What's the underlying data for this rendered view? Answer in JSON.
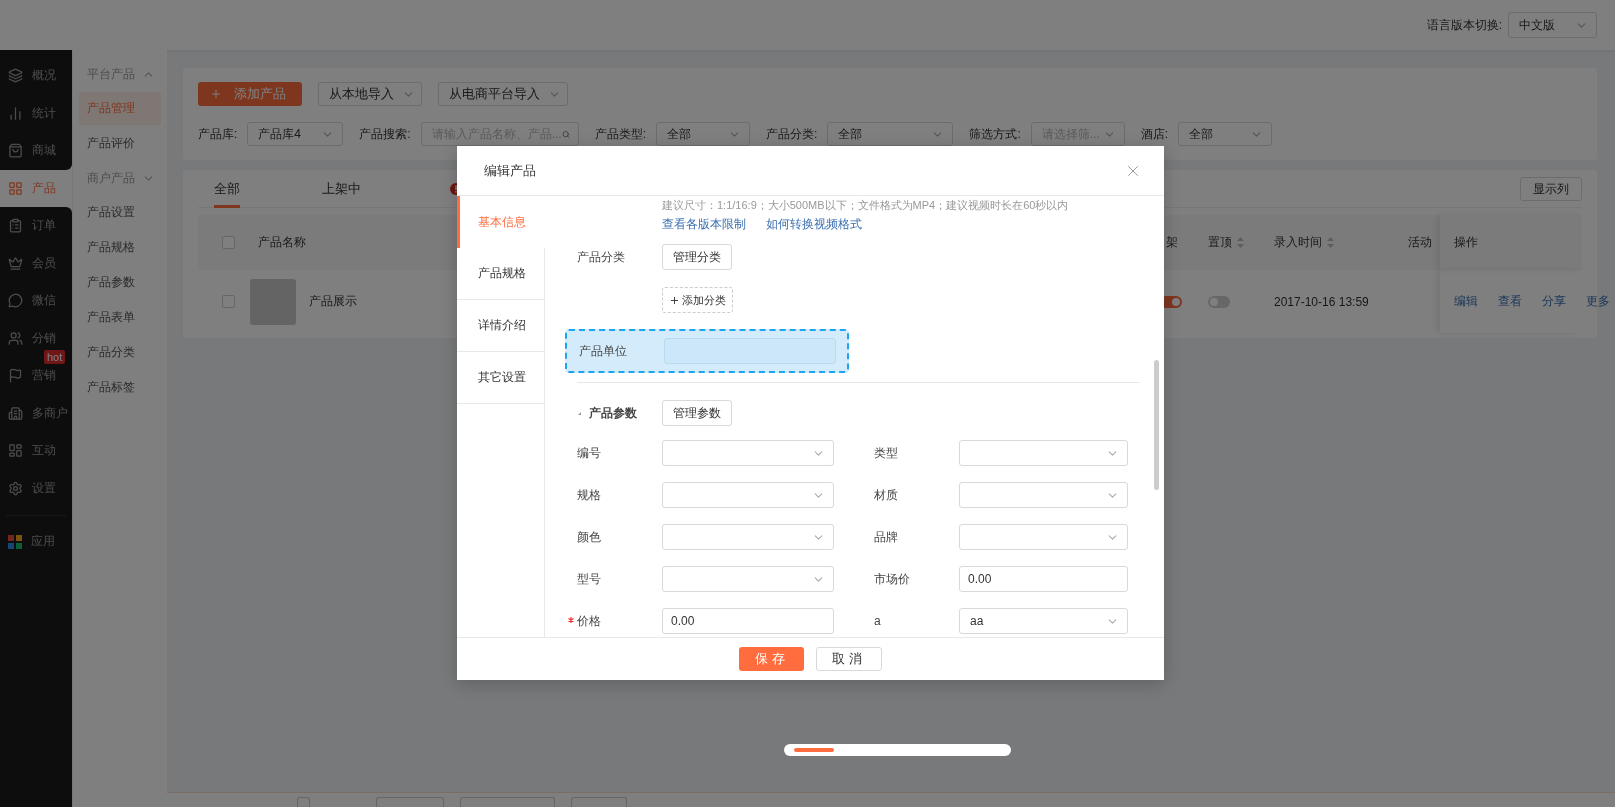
{
  "top_bar": {
    "language_label": "语言版本切换:",
    "language": "中文版"
  },
  "main_nav": [
    {
      "label": "概况",
      "selected": false
    },
    {
      "label": "统计",
      "selected": false
    },
    {
      "label": "商城",
      "selected": false
    },
    {
      "label": "产品",
      "selected": true
    },
    {
      "label": "订单",
      "selected": false
    },
    {
      "label": "会员",
      "selected": false
    },
    {
      "label": "微信",
      "selected": false
    },
    {
      "label": "分销",
      "selected": false
    },
    {
      "label": "营销",
      "selected": false,
      "badge": "hot"
    },
    {
      "label": "多商户",
      "selected": false
    },
    {
      "label": "互动",
      "selected": false
    },
    {
      "label": "设置",
      "selected": false
    }
  ],
  "apps_nav": [
    {
      "label": "应用",
      "selected": false
    }
  ],
  "sub_nav": [
    {
      "kind": "group",
      "label": "平台产品",
      "expanded": true,
      "children": [
        {
          "kind": "item",
          "label": "产品管理",
          "selected": true
        },
        {
          "kind": "item",
          "label": "产品评价",
          "selected": false
        }
      ]
    },
    {
      "kind": "group",
      "label": "商户产品",
      "expanded": false
    },
    {
      "kind": "item",
      "label": "产品设置",
      "selected": false
    },
    {
      "kind": "item",
      "label": "产品规格",
      "selected": false
    },
    {
      "kind": "item",
      "label": "产品参数",
      "selected": false
    },
    {
      "kind": "item",
      "label": "产品表单",
      "selected": false
    },
    {
      "kind": "item",
      "label": "产品分类",
      "selected": false
    },
    {
      "kind": "item",
      "label": "产品标签",
      "selected": false
    }
  ],
  "toolbar": {
    "add_button": "添加产品",
    "import_buttons": [
      "从本地导入",
      "从电商平台导入"
    ]
  },
  "filters": [
    {
      "kind": "select",
      "label": "产品库:",
      "value": "产品库4"
    },
    {
      "kind": "search",
      "label": "产品搜索:",
      "placeholder": "请输入产品名称、产品..."
    },
    {
      "kind": "select",
      "label": "产品类型:",
      "value": "全部"
    },
    {
      "kind": "select",
      "label": "产品分类:",
      "value": "全部"
    },
    {
      "kind": "select",
      "label": "筛选方式:",
      "placeholder": "请选择筛..."
    },
    {
      "kind": "select",
      "label": "酒店:",
      "value": "全部"
    }
  ],
  "tabs": [
    {
      "label": "全部",
      "selected": true
    },
    {
      "label": "上架中",
      "selected": false
    }
  ],
  "show_columns_button": "显示列",
  "bottom_bar": {
    "select_all_checked": false
  },
  "table": {
    "header_checked": false,
    "columns": [
      {
        "label": "产品名称"
      },
      {
        "label": "架"
      },
      {
        "label": "置顶",
        "sortable": true
      },
      {
        "label": "录入时间",
        "sortable": true
      },
      {
        "label": "活动"
      },
      {
        "label": "操作"
      }
    ],
    "rows": [
      {
        "checked": false,
        "name": "产品展示",
        "listed": true,
        "pinned": false,
        "date": "2017-10-16 13:59",
        "actions": [
          "编辑",
          "查看",
          "分享",
          "更多"
        ]
      }
    ]
  },
  "modal": {
    "title": "编辑产品",
    "tabs": [
      {
        "label": "基本信息",
        "selected": true
      },
      {
        "label": "产品规格",
        "selected": false
      },
      {
        "label": "详情介绍",
        "selected": false
      },
      {
        "label": "其它设置",
        "selected": false
      }
    ],
    "note": "建议尺寸：1:1/16:9；大小500MB以下；文件格式为MP4；建议视频时长在60秒以内",
    "links": [
      "查看各版本限制",
      "如何转换视频格式"
    ],
    "category": {
      "label": "产品分类",
      "manage_button": "管理分类",
      "add_button": "添加分类"
    },
    "unit": {
      "label": "产品单位",
      "focused": true
    },
    "params": {
      "title": "产品参数",
      "manage_button": "管理参数",
      "expanded": true
    },
    "fields": [
      {
        "kind": "select",
        "label": "编号"
      },
      {
        "kind": "select",
        "label": "类型"
      },
      {
        "kind": "select",
        "label": "规格"
      },
      {
        "kind": "select",
        "label": "材质"
      },
      {
        "kind": "select",
        "label": "颜色"
      },
      {
        "kind": "select",
        "label": "品牌"
      },
      {
        "kind": "select",
        "label": "型号"
      },
      {
        "kind": "text",
        "label": "市场价",
        "value": "0.00"
      },
      {
        "kind": "text",
        "label": "价格",
        "value": "0.00",
        "required": true
      },
      {
        "kind": "select",
        "label": "a",
        "value": "aa"
      }
    ],
    "save_button": "保存",
    "cancel_button": "取消"
  }
}
